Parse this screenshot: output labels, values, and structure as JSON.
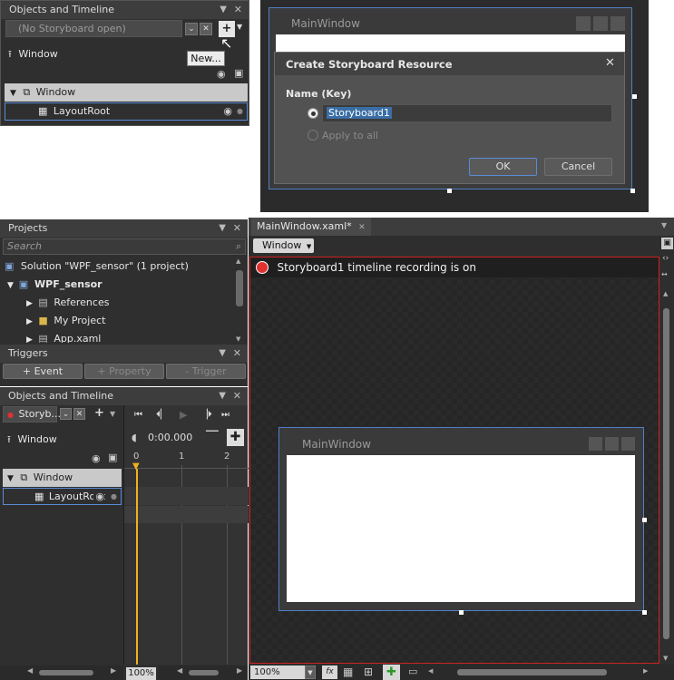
{
  "top_left_panel": {
    "title": "Objects and Timeline",
    "storyboard": "(No Storyboard open)",
    "window_label": "Window",
    "tooltip": "New...",
    "tree_window": "Window",
    "tree_layoutroot": "LayoutRoot"
  },
  "dialog": {
    "bg_window_title": "MainWindow",
    "title": "Create Storyboard Resource",
    "name_key_label": "Name (Key)",
    "name_value": "Storyboard1",
    "apply_all_label": "Apply to all",
    "ok_label": "OK",
    "cancel_label": "Cancel"
  },
  "projects_panel": {
    "title": "Projects",
    "search_placeholder": "Search",
    "items": [
      "Solution \"WPF_sensor\" (1 project)",
      "WPF_sensor",
      "References",
      "My Project",
      "App.xaml"
    ]
  },
  "triggers_panel": {
    "title": "Triggers",
    "event_label": "+ Event",
    "property_label": "+ Property",
    "trigger_label": "- Trigger"
  },
  "timeline_panel": {
    "title": "Objects and Timeline",
    "storyboard": "Storyb...",
    "window_label": "Window",
    "time": "0:00.000",
    "ticks": [
      "0",
      "1",
      "2"
    ],
    "tree_window": "Window",
    "tree_layoutroot": "LayoutRoot",
    "zoom": "100%"
  },
  "editor": {
    "tab_label": "MainWindow.xaml*",
    "breadcrumb": "Window",
    "recording_text": "Storyboard1 timeline recording is on",
    "canvas_window_title": "MainWindow",
    "zoom": "100%"
  }
}
